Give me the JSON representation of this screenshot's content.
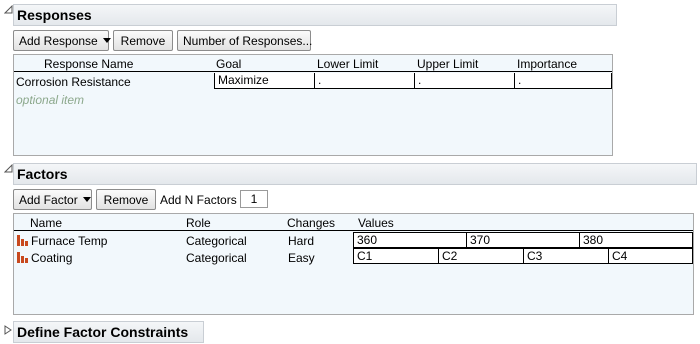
{
  "responses": {
    "title": "Responses",
    "buttons": {
      "add_response": "Add Response",
      "remove": "Remove",
      "number_of_responses": "Number of Responses..."
    },
    "columns": [
      "Response Name",
      "Goal",
      "Lower Limit",
      "Upper Limit",
      "Importance"
    ],
    "rows": [
      {
        "name": "Corrosion Resistance",
        "goal": "Maximize",
        "lower": ".",
        "upper": ".",
        "importance": "."
      }
    ],
    "optional_item": "optional item"
  },
  "factors": {
    "title": "Factors",
    "buttons": {
      "add_factor": "Add Factor",
      "remove": "Remove",
      "add_n_factors_label": "Add N Factors",
      "add_n_factors_value": "1"
    },
    "columns": [
      "Name",
      "Role",
      "Changes",
      "Values"
    ],
    "rows": [
      {
        "name": "Furnace Temp",
        "role": "Categorical",
        "changes": "Hard",
        "values": [
          "360",
          "370",
          "380"
        ]
      },
      {
        "name": "Coating",
        "role": "Categorical",
        "changes": "Easy",
        "values": [
          "C1",
          "C2",
          "C3",
          "C4"
        ]
      }
    ]
  },
  "constraints": {
    "title": "Define Factor Constraints"
  },
  "colors": {
    "factor_icon": "#c8491e",
    "header_bg": "#e8ebee"
  },
  "icons": {
    "open": "triangle-down-icon",
    "closed": "triangle-right-icon",
    "factor": "categorical-factor-icon"
  }
}
